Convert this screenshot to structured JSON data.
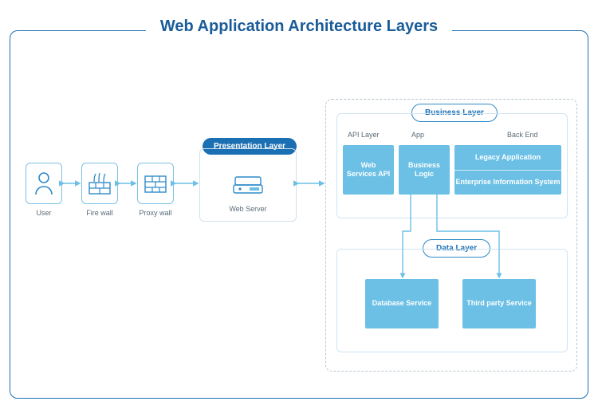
{
  "title": "Web Application Architecture Layers",
  "chain": {
    "user": "User",
    "firewall": "Fire wall",
    "proxy": "Proxy wall",
    "webserver": "Web Server"
  },
  "badges": {
    "presentation": "Presentation Layer",
    "business": "Business Layer",
    "data": "Data Layer"
  },
  "bizColumns": {
    "api": "API Layer",
    "app": "App",
    "backend": "Back End"
  },
  "components": {
    "webServicesApi": "Web Services API",
    "businessLogic": "Business Logic",
    "legacyApp": "Legacy Application",
    "eis": "Enterprise Information System",
    "database": "Database Service",
    "thirdParty": "Third party Service"
  },
  "colors": {
    "accent": "#1b6fb3",
    "light": "#6cc0e5"
  }
}
